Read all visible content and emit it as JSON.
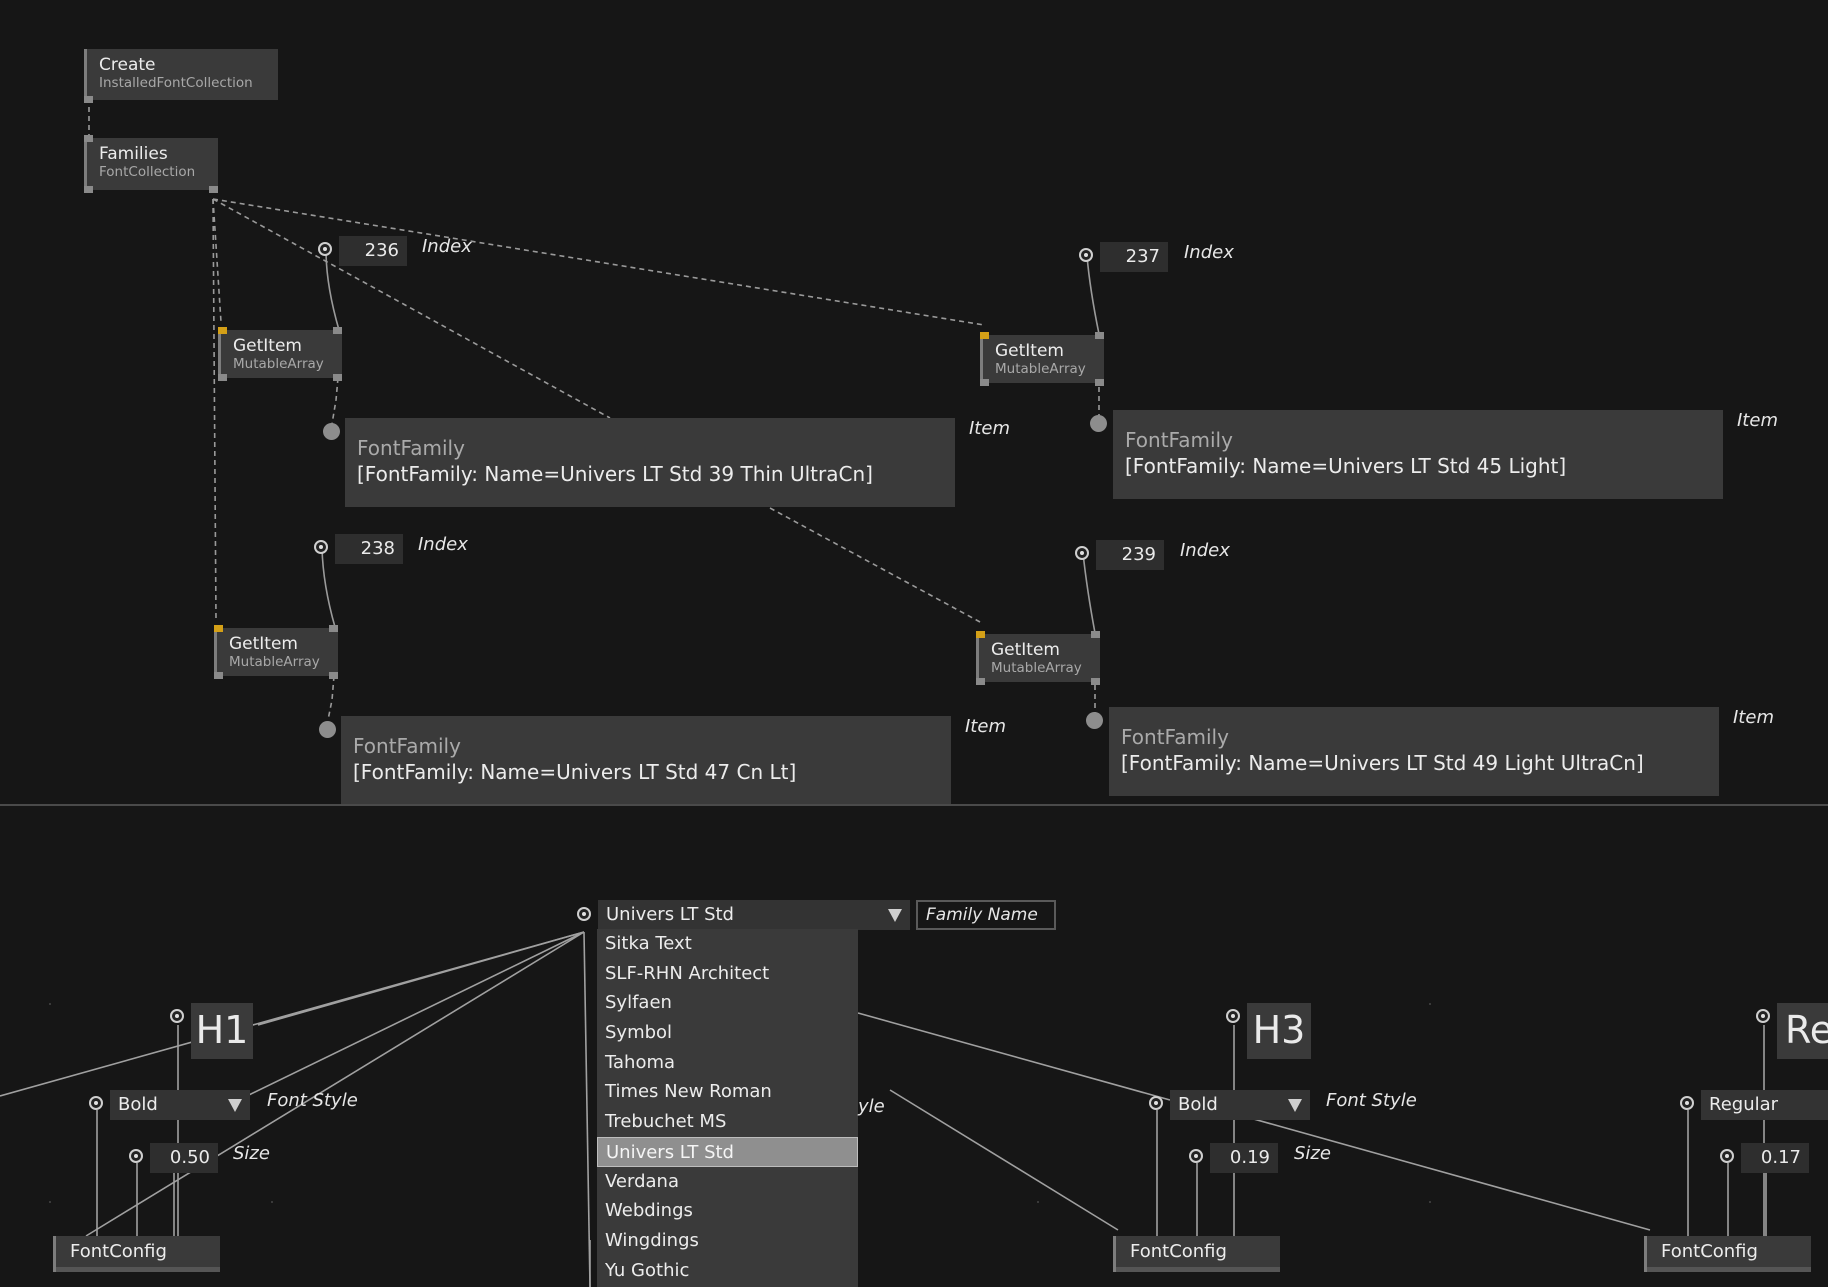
{
  "upper": {
    "create_node": {
      "title": "Create",
      "subtitle": "InstalledFontCollection"
    },
    "families_node": {
      "title": "Families",
      "subtitle": "FontCollection"
    },
    "getitems": [
      {
        "title": "GetItem",
        "subtitle": "MutableArray",
        "index": "236",
        "index_label": "Index",
        "item_label": "Item",
        "tip_type": "FontFamily",
        "tip_value": "[FontFamily: Name=Univers LT Std 39 Thin UltraCn]"
      },
      {
        "title": "GetItem",
        "subtitle": "MutableArray",
        "index": "237",
        "index_label": "Index",
        "item_label": "Item",
        "tip_type": "FontFamily",
        "tip_value": "[FontFamily: Name=Univers LT Std 45 Light]"
      },
      {
        "title": "GetItem",
        "subtitle": "MutableArray",
        "index": "238",
        "index_label": "Index",
        "item_label": "Item",
        "tip_type": "FontFamily",
        "tip_value": "[FontFamily: Name=Univers LT Std 47 Cn Lt]"
      },
      {
        "title": "GetItem",
        "subtitle": "MutableArray",
        "index": "239",
        "index_label": "Index",
        "item_label": "Item",
        "tip_type": "FontFamily",
        "tip_value": "[FontFamily: Name=Univers LT Std 49 Light UltraCn]"
      }
    ]
  },
  "lower": {
    "family_combo": {
      "value": "Univers LT Std",
      "label": "Family Name"
    },
    "family_options": [
      "Sitka Text",
      "SLF-RHN Architect",
      "Sylfaen",
      "Symbol",
      "Tahoma",
      "Times New Roman",
      "Trebuchet MS",
      "Univers LT Std",
      "Verdana",
      "Webdings",
      "Wingdings",
      "Yu Gothic"
    ],
    "selected_option": "Univers LT Std",
    "hidden_label_fragment": "yle",
    "groups": [
      {
        "heading": "H1",
        "style": "Bold",
        "style_label": "Font Style",
        "size": "0.50",
        "size_label": "Size",
        "node": "FontConfig"
      },
      {
        "heading": "H3",
        "style": "Bold",
        "style_label": "Font Style",
        "size": "0.19",
        "size_label": "Size",
        "node": "FontConfig"
      },
      {
        "heading": "Re",
        "style": "Regular",
        "style_label": "",
        "size": "0.17",
        "size_label": "",
        "node": "FontConfig"
      }
    ]
  },
  "colors": {
    "background": "#161616",
    "node": "#3a3a3a",
    "wire": "#9a9a9a",
    "pin_highlight": "#d4a017"
  }
}
